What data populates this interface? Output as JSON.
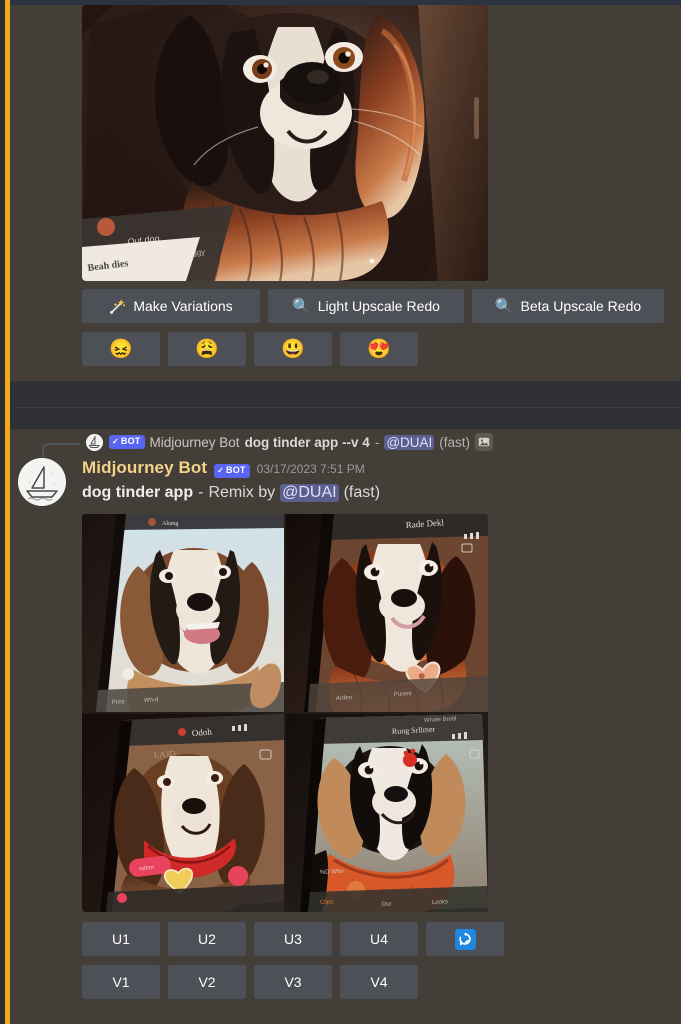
{
  "app": {
    "platform": "Discord",
    "theme_colors": {
      "background": "#433e38",
      "separator_band": "#303136",
      "button": "#4e5058",
      "mention": "#5a5f8d",
      "bot_badge": "#5865f2",
      "username": "#f2d388",
      "unread_bar": "#f0a91e",
      "refresh_accent": "#1f87dd"
    }
  },
  "message_upscaled": {
    "image_alt": "Upscaled AI render of a black-and-tan collie style dog shown on a smartphone screen, dog tinder app concept",
    "action_buttons": [
      {
        "label": "Make Variations",
        "icon": "sparkle-wand-icon",
        "name": "make-variations-button"
      },
      {
        "label": "Light Upscale Redo",
        "icon": "magnifier-icon",
        "name": "light-upscale-redo-button"
      },
      {
        "label": "Beta Upscale Redo",
        "icon": "magnifier-icon",
        "name": "beta-upscale-redo-button"
      }
    ],
    "reaction_buttons": [
      {
        "emoji": "😖",
        "name": "reaction-confounded-button"
      },
      {
        "emoji": "😩",
        "name": "reaction-weary-button"
      },
      {
        "emoji": "😃",
        "name": "reaction-grinning-button"
      },
      {
        "emoji": "😍",
        "name": "reaction-heart-eyes-button"
      }
    ]
  },
  "reply_reference": {
    "bot_badge": "BOT",
    "bot_check": "✓",
    "author": "Midjourney Bot",
    "prompt": "dog tinder app --v 4",
    "dash": "-",
    "mention": "@DUAI",
    "mode": "(fast)",
    "attachment_icon": "image-icon"
  },
  "message_grid": {
    "author": "Midjourney Bot",
    "bot_badge": "BOT",
    "bot_check": "✓",
    "timestamp": "03/17/2023 7:51 PM",
    "prompt": "dog tinder app",
    "dash": "-",
    "remix_label": "Remix by",
    "mention": "@DUAI",
    "mode": "(fast)",
    "grid_images": [
      {
        "alt": "Smiling beagle-collie mix dog portrait on a phone screen, light blue app header",
        "name": "grid-image-1"
      },
      {
        "alt": "Red-and-white Bernese style dog portrait on a phone with heart sticker overlay",
        "name": "grid-image-2"
      },
      {
        "alt": "Brown and white spaniel with a red collar on a phone screen with chat bubbles",
        "name": "grid-image-3"
      },
      {
        "alt": "Black and white dog wearing an orange sweater on a phone screen",
        "name": "grid-image-4"
      }
    ],
    "upscale_buttons": [
      {
        "label": "U1",
        "name": "upscale-1-button"
      },
      {
        "label": "U2",
        "name": "upscale-2-button"
      },
      {
        "label": "U3",
        "name": "upscale-3-button"
      },
      {
        "label": "U4",
        "name": "upscale-4-button"
      }
    ],
    "reroll_button": {
      "icon": "refresh-icon",
      "name": "reroll-button"
    },
    "variation_buttons": [
      {
        "label": "V1",
        "name": "variation-1-button"
      },
      {
        "label": "V2",
        "name": "variation-2-button"
      },
      {
        "label": "V3",
        "name": "variation-3-button"
      },
      {
        "label": "V4",
        "name": "variation-4-button"
      }
    ]
  }
}
